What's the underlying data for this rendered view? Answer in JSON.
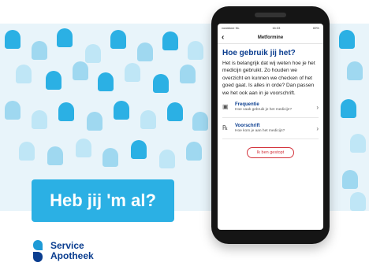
{
  "tagline": "Heb jij 'm al?",
  "brand": {
    "line1": "Service",
    "line2": "Apotheek",
    "colors": {
      "light_blue": "#1e9ad6",
      "dark_blue": "#0a3d8f"
    }
  },
  "status_bar": {
    "carrier": "vodafone NL",
    "time": "16:33",
    "battery": "69%"
  },
  "nav": {
    "back_icon": "chevron-left-icon",
    "title": "Metformine"
  },
  "main": {
    "heading": "Hoe gebruik jij het?",
    "body": "Het is belangrijk dat wij weten hoe je het medicijn gebruikt. Zo houden we overzicht en kunnen we checken of het goed gaat. Is alles in orde? Dan passen we het ook aan in je voorschrift."
  },
  "items": [
    {
      "title": "Frequentie",
      "subtitle": "Hoe vaak gebruik je het medicijn?",
      "icon": "calendar-icon"
    },
    {
      "title": "Voorschrift",
      "subtitle": "Hoe kom je aan het medicijn?",
      "icon": "prescription-icon"
    }
  ],
  "stop_button": "Ik ben gestopt",
  "accent_colors": {
    "cyan": "#2bb0e4",
    "red": "#d3343d",
    "bg_light": "#e8f4fa"
  }
}
